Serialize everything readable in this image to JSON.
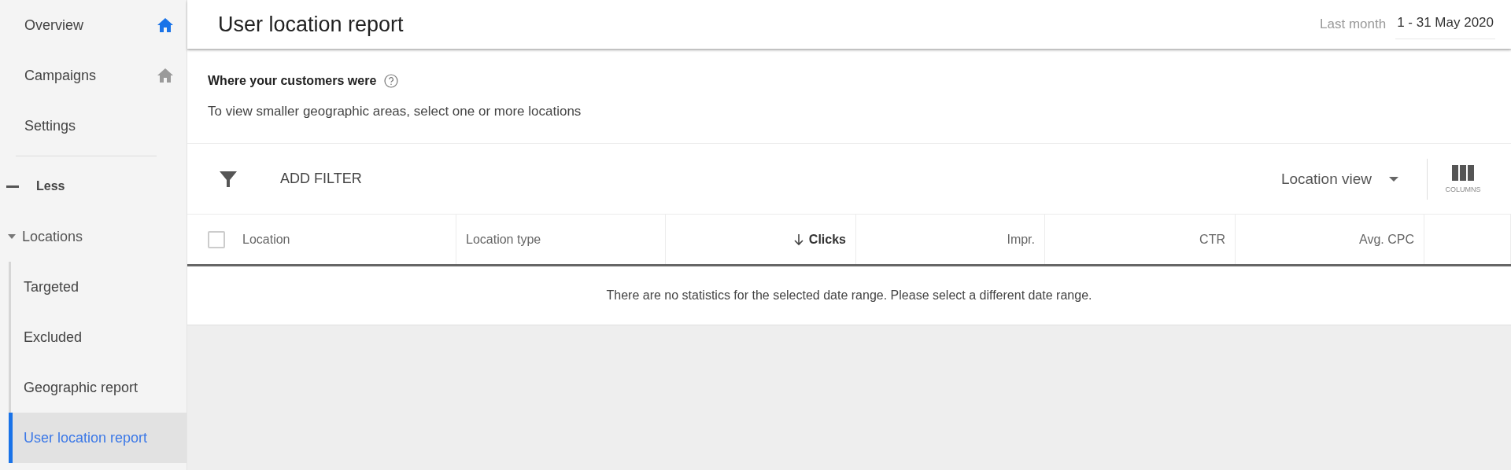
{
  "sidebar": {
    "items": [
      {
        "label": "Overview",
        "kind": "pinned",
        "active": true,
        "selected": false
      },
      {
        "label": "Campaigns",
        "kind": "pinned",
        "active": false,
        "selected": false
      },
      {
        "label": "Settings",
        "kind": "plain",
        "selected": false
      }
    ],
    "less_toggle": {
      "label": "Less"
    },
    "group": {
      "label": "Locations",
      "expanded": true,
      "children": [
        {
          "label": "Targeted",
          "selected": false
        },
        {
          "label": "Excluded",
          "selected": false
        },
        {
          "label": "Geographic report",
          "selected": false
        },
        {
          "label": "User location report",
          "selected": true
        }
      ]
    }
  },
  "header": {
    "title": "User location report",
    "date_label": "Last month",
    "date_range": "1 - 31 May 2020"
  },
  "section": {
    "heading": "Where your customers were",
    "subtitle": "To view smaller geographic areas, select one or more locations"
  },
  "toolbar": {
    "filter_label": "ADD FILTER",
    "view_select": "Location view",
    "columns_label": "COLUMNS"
  },
  "table": {
    "select_all_checked": false,
    "columns": [
      {
        "label": "Location",
        "kind": "text",
        "sorted": false
      },
      {
        "label": "Location type",
        "kind": "text",
        "sorted": false
      },
      {
        "label": "Clicks",
        "kind": "metric",
        "sorted": true
      },
      {
        "label": "Impr.",
        "kind": "metric",
        "sorted": false
      },
      {
        "label": "CTR",
        "kind": "metric",
        "sorted": false
      },
      {
        "label": "Avg. CPC",
        "kind": "metric",
        "sorted": false
      }
    ],
    "empty_message": "There are no statistics for the selected date range. Please select a different date range."
  }
}
